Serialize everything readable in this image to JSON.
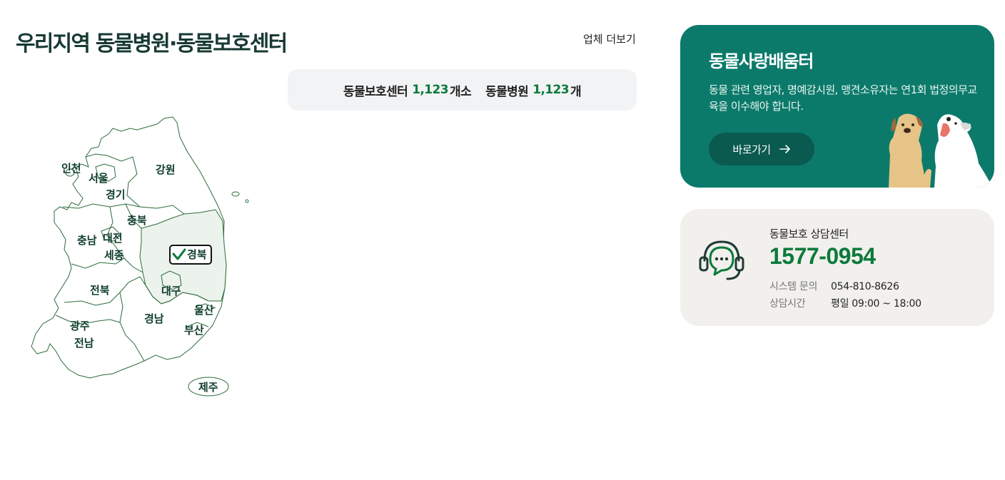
{
  "section": {
    "title": "우리지역 동물병원·동물보호센터",
    "more_link": "업체 더보기"
  },
  "counts": {
    "shelter_label": "동물보호센터",
    "shelter_count": "1,123",
    "shelter_unit": "개소",
    "hospital_label": "동물병원",
    "hospital_count": "1,123",
    "hospital_unit": "개"
  },
  "map": {
    "selected": "경북",
    "regions": [
      {
        "label": "인천"
      },
      {
        "label": "서울"
      },
      {
        "label": "강원"
      },
      {
        "label": "경기"
      },
      {
        "label": "충북"
      },
      {
        "label": "충남"
      },
      {
        "label": "대전"
      },
      {
        "label": "세종"
      },
      {
        "label": "경북"
      },
      {
        "label": "전북"
      },
      {
        "label": "대구"
      },
      {
        "label": "울산"
      },
      {
        "label": "경남"
      },
      {
        "label": "광주"
      },
      {
        "label": "부산"
      },
      {
        "label": "전남"
      },
      {
        "label": "제주"
      }
    ]
  },
  "banner": {
    "title": "동물사랑배움터",
    "description": "동물 관련 영업자, 명예감시원, 맹견소유자는 연1회 법정의무교육을 이수해야 합니다.",
    "button_label": "바로가기",
    "colors": {
      "background": "#0c7a6b",
      "button": "#0a5a50"
    }
  },
  "call_center": {
    "label": "동물보호 상담센터",
    "phone": "1577-0954",
    "system_label": "시스템 문의",
    "system_phone": "054-810-8626",
    "hours_label": "상담시간",
    "hours_value": "평일 09:00 ~ 18:00"
  },
  "colors": {
    "accent": "#0b7a3b",
    "title": "#173a33"
  }
}
